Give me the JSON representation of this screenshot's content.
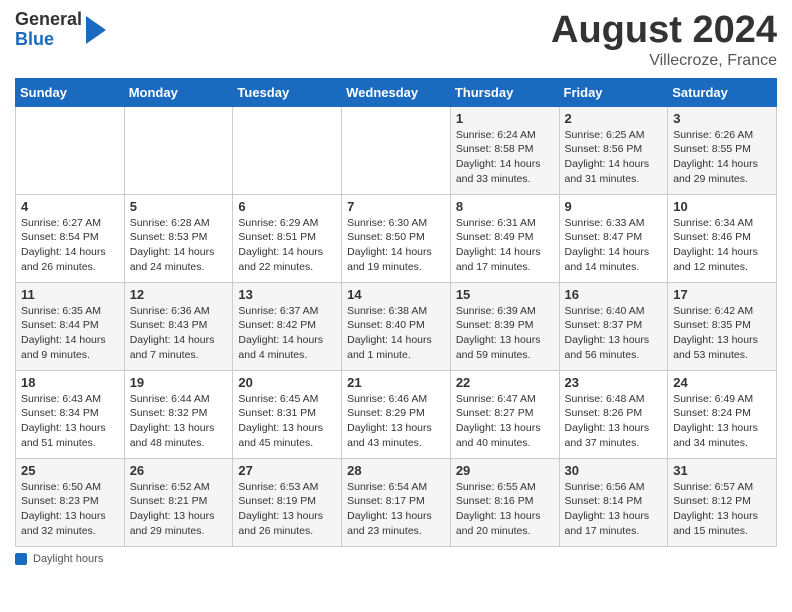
{
  "header": {
    "logo_general": "General",
    "logo_blue": "Blue",
    "month_title": "August 2024",
    "subtitle": "Villecroze, France"
  },
  "footer": {
    "label": "Daylight hours"
  },
  "calendar": {
    "days_of_week": [
      "Sunday",
      "Monday",
      "Tuesday",
      "Wednesday",
      "Thursday",
      "Friday",
      "Saturday"
    ],
    "weeks": [
      [
        {
          "day": "",
          "info": ""
        },
        {
          "day": "",
          "info": ""
        },
        {
          "day": "",
          "info": ""
        },
        {
          "day": "",
          "info": ""
        },
        {
          "day": "1",
          "info": "Sunrise: 6:24 AM\nSunset: 8:58 PM\nDaylight: 14 hours and 33 minutes."
        },
        {
          "day": "2",
          "info": "Sunrise: 6:25 AM\nSunset: 8:56 PM\nDaylight: 14 hours and 31 minutes."
        },
        {
          "day": "3",
          "info": "Sunrise: 6:26 AM\nSunset: 8:55 PM\nDaylight: 14 hours and 29 minutes."
        }
      ],
      [
        {
          "day": "4",
          "info": "Sunrise: 6:27 AM\nSunset: 8:54 PM\nDaylight: 14 hours and 26 minutes."
        },
        {
          "day": "5",
          "info": "Sunrise: 6:28 AM\nSunset: 8:53 PM\nDaylight: 14 hours and 24 minutes."
        },
        {
          "day": "6",
          "info": "Sunrise: 6:29 AM\nSunset: 8:51 PM\nDaylight: 14 hours and 22 minutes."
        },
        {
          "day": "7",
          "info": "Sunrise: 6:30 AM\nSunset: 8:50 PM\nDaylight: 14 hours and 19 minutes."
        },
        {
          "day": "8",
          "info": "Sunrise: 6:31 AM\nSunset: 8:49 PM\nDaylight: 14 hours and 17 minutes."
        },
        {
          "day": "9",
          "info": "Sunrise: 6:33 AM\nSunset: 8:47 PM\nDaylight: 14 hours and 14 minutes."
        },
        {
          "day": "10",
          "info": "Sunrise: 6:34 AM\nSunset: 8:46 PM\nDaylight: 14 hours and 12 minutes."
        }
      ],
      [
        {
          "day": "11",
          "info": "Sunrise: 6:35 AM\nSunset: 8:44 PM\nDaylight: 14 hours and 9 minutes."
        },
        {
          "day": "12",
          "info": "Sunrise: 6:36 AM\nSunset: 8:43 PM\nDaylight: 14 hours and 7 minutes."
        },
        {
          "day": "13",
          "info": "Sunrise: 6:37 AM\nSunset: 8:42 PM\nDaylight: 14 hours and 4 minutes."
        },
        {
          "day": "14",
          "info": "Sunrise: 6:38 AM\nSunset: 8:40 PM\nDaylight: 14 hours and 1 minute."
        },
        {
          "day": "15",
          "info": "Sunrise: 6:39 AM\nSunset: 8:39 PM\nDaylight: 13 hours and 59 minutes."
        },
        {
          "day": "16",
          "info": "Sunrise: 6:40 AM\nSunset: 8:37 PM\nDaylight: 13 hours and 56 minutes."
        },
        {
          "day": "17",
          "info": "Sunrise: 6:42 AM\nSunset: 8:35 PM\nDaylight: 13 hours and 53 minutes."
        }
      ],
      [
        {
          "day": "18",
          "info": "Sunrise: 6:43 AM\nSunset: 8:34 PM\nDaylight: 13 hours and 51 minutes."
        },
        {
          "day": "19",
          "info": "Sunrise: 6:44 AM\nSunset: 8:32 PM\nDaylight: 13 hours and 48 minutes."
        },
        {
          "day": "20",
          "info": "Sunrise: 6:45 AM\nSunset: 8:31 PM\nDaylight: 13 hours and 45 minutes."
        },
        {
          "day": "21",
          "info": "Sunrise: 6:46 AM\nSunset: 8:29 PM\nDaylight: 13 hours and 43 minutes."
        },
        {
          "day": "22",
          "info": "Sunrise: 6:47 AM\nSunset: 8:27 PM\nDaylight: 13 hours and 40 minutes."
        },
        {
          "day": "23",
          "info": "Sunrise: 6:48 AM\nSunset: 8:26 PM\nDaylight: 13 hours and 37 minutes."
        },
        {
          "day": "24",
          "info": "Sunrise: 6:49 AM\nSunset: 8:24 PM\nDaylight: 13 hours and 34 minutes."
        }
      ],
      [
        {
          "day": "25",
          "info": "Sunrise: 6:50 AM\nSunset: 8:23 PM\nDaylight: 13 hours and 32 minutes."
        },
        {
          "day": "26",
          "info": "Sunrise: 6:52 AM\nSunset: 8:21 PM\nDaylight: 13 hours and 29 minutes."
        },
        {
          "day": "27",
          "info": "Sunrise: 6:53 AM\nSunset: 8:19 PM\nDaylight: 13 hours and 26 minutes."
        },
        {
          "day": "28",
          "info": "Sunrise: 6:54 AM\nSunset: 8:17 PM\nDaylight: 13 hours and 23 minutes."
        },
        {
          "day": "29",
          "info": "Sunrise: 6:55 AM\nSunset: 8:16 PM\nDaylight: 13 hours and 20 minutes."
        },
        {
          "day": "30",
          "info": "Sunrise: 6:56 AM\nSunset: 8:14 PM\nDaylight: 13 hours and 17 minutes."
        },
        {
          "day": "31",
          "info": "Sunrise: 6:57 AM\nSunset: 8:12 PM\nDaylight: 13 hours and 15 minutes."
        }
      ]
    ]
  }
}
